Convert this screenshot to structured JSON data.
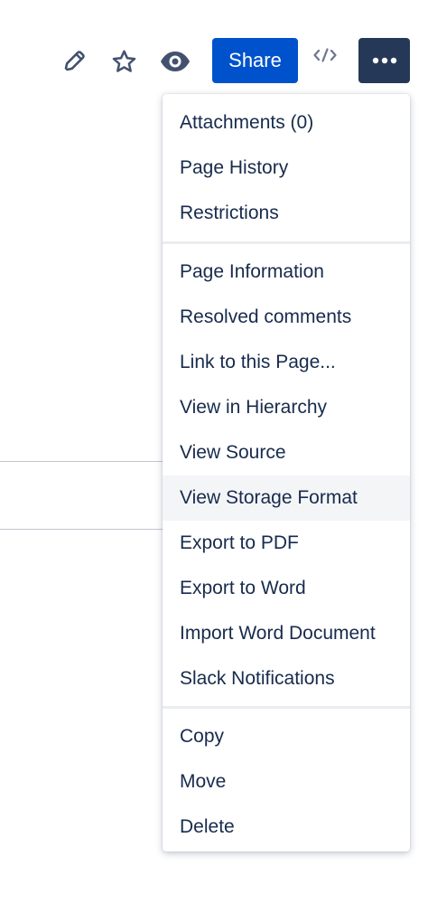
{
  "toolbar": {
    "icons": {
      "edit": "pencil-icon",
      "star": "star-icon",
      "watch": "eye-icon",
      "code": "code-icon",
      "more": "more-icon"
    },
    "share_label": "Share",
    "code_label": "</>"
  },
  "menu": {
    "groups": [
      {
        "items": [
          {
            "label": "Attachments (0)"
          },
          {
            "label": "Page History"
          },
          {
            "label": "Restrictions"
          }
        ]
      },
      {
        "items": [
          {
            "label": "Page Information"
          },
          {
            "label": "Resolved comments"
          },
          {
            "label": "Link to this Page..."
          },
          {
            "label": "View in Hierarchy"
          },
          {
            "label": "View Source"
          },
          {
            "label": "View Storage Format"
          },
          {
            "label": "Export to PDF"
          },
          {
            "label": "Export to Word"
          },
          {
            "label": "Import Word Document"
          },
          {
            "label": "Slack Notifications"
          }
        ]
      },
      {
        "items": [
          {
            "label": "Copy"
          },
          {
            "label": "Move"
          },
          {
            "label": "Delete"
          }
        ]
      }
    ]
  },
  "colors": {
    "primary_blue": "#0052cc",
    "dark_navy": "#253858",
    "text": "#172b4d",
    "icon": "#42526e",
    "hover": "#f4f5f7",
    "divider": "#ebecf0"
  }
}
